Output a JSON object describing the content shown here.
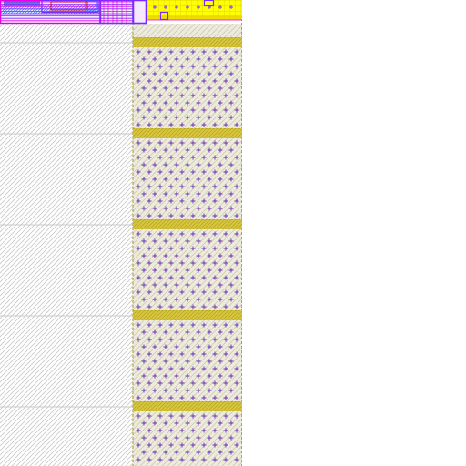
{
  "layout_view": {
    "layers": {
      "hatched_region": {
        "fill": "#ffffff",
        "hatch_color": "#c8c8c8",
        "grid_line_color": "#c8c8d2"
      },
      "cell_column": {
        "fill": "#ecebdd",
        "hatch_color": "#c9c7a6",
        "edge_color": "#b2a64a"
      },
      "rails": {
        "color": "#d8c63c",
        "hatch_color": "#b9a826"
      },
      "contacts": {
        "color": "#6a2bb5"
      },
      "metal_top": {
        "color": "#ffff00",
        "grid_color": "#dcc800"
      },
      "routing": {
        "magenta": "#e000e0",
        "violet": "#7a2cff",
        "blue": "#2b5cff",
        "red": "#e00000"
      }
    },
    "background": "#ffffff"
  }
}
